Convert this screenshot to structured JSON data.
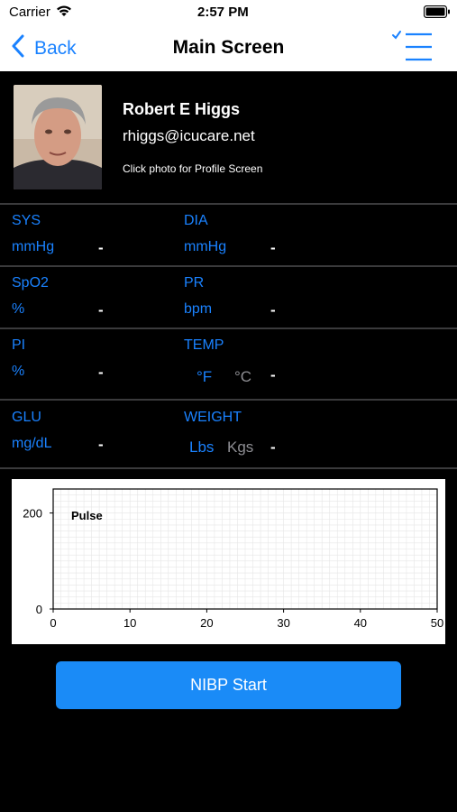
{
  "status": {
    "carrier": "Carrier",
    "time": "2:57 PM"
  },
  "nav": {
    "back_label": "Back",
    "title": "Main Screen",
    "menu_icon": "checklist-menu-icon"
  },
  "profile": {
    "name": "Robert E Higgs",
    "email": "rhiggs@icucare.net",
    "hint": "Click photo for Profile Screen"
  },
  "vitals": {
    "sys": {
      "label": "SYS",
      "unit": "mmHg",
      "value": "-"
    },
    "dia": {
      "label": "DIA",
      "unit": "mmHg",
      "value": "-"
    },
    "spo2": {
      "label": "SpO2",
      "unit": "%",
      "value": "-"
    },
    "pr": {
      "label": "PR",
      "unit": "bpm",
      "value": "-"
    },
    "pi": {
      "label": "PI",
      "unit": "%",
      "value": "-"
    },
    "temp": {
      "label": "TEMP",
      "unit_f": "°F",
      "unit_c": "°C",
      "value": "-"
    },
    "glu": {
      "label": "GLU",
      "unit": "mg/dL",
      "value": "-"
    },
    "weight": {
      "label": "WEIGHT",
      "unit_lbs": "Lbs",
      "unit_kgs": "Kgs",
      "value": "-"
    }
  },
  "chart_data": {
    "type": "line",
    "title": "",
    "series": [
      {
        "name": "Pulse",
        "x": [],
        "y": []
      }
    ],
    "xlabel": "",
    "ylabel": "",
    "xlim": [
      0,
      50
    ],
    "ylim": [
      0,
      250
    ],
    "x_ticks": [
      "0",
      "10",
      "20",
      "30",
      "40",
      "50"
    ],
    "y_ticks": [
      "0",
      "200"
    ],
    "grid": true,
    "legend": "top-left"
  },
  "actions": {
    "nibp_label": "NIBP Start"
  },
  "colors": {
    "accent": "#1a82ff",
    "button": "#1a8bf7",
    "background": "#000000"
  }
}
